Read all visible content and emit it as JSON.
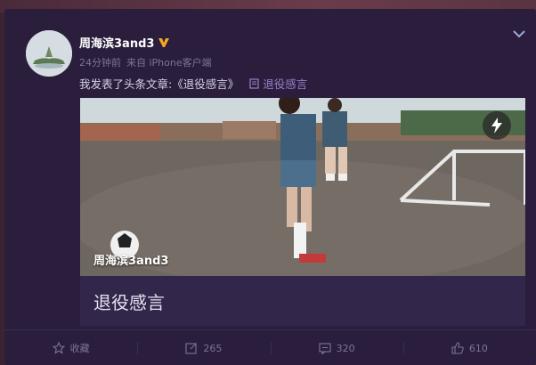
{
  "user": {
    "name": "周海滨3and3",
    "verified_icon": "verified-v-icon",
    "time": "24分钟前",
    "source": "来自 iPhone客户端"
  },
  "post": {
    "text": "我发表了头条文章:《退役感言》",
    "article_link": "退役感言"
  },
  "article": {
    "photo_author": "周海滨3and3",
    "title": "退役感言",
    "lightning_icon": "lightning-icon"
  },
  "actions": {
    "favorite": "收藏",
    "repost": "265",
    "comment": "320",
    "like": "610"
  },
  "colors": {
    "background": "#2a1e3c",
    "accent_link": "#9a7fc9",
    "muted": "#7d7496",
    "verified": "#f5a623"
  }
}
